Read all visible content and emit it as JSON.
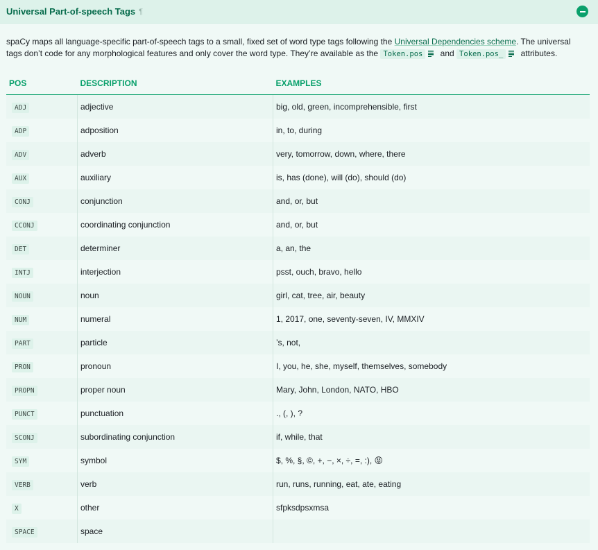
{
  "header": {
    "title": "Universal Part-of-speech Tags",
    "pilcrow": "¶"
  },
  "intro": {
    "text1": "spaCy maps all language-specific part-of-speech tags to a small, fixed set of word type tags following the ",
    "link": "Universal Dependencies scheme",
    "text2": ". The universal tags don’t code for any morphological features and only cover the word type. They’re available as the ",
    "code1": "Token.pos",
    "text3": " and ",
    "code2": "Token.pos_",
    "text4": " attributes."
  },
  "table": {
    "headers": [
      "POS",
      "DESCRIPTION",
      "EXAMPLES"
    ],
    "rows": [
      {
        "pos": "ADJ",
        "desc": "adjective",
        "ex": "big, old, green, incomprehensible, first"
      },
      {
        "pos": "ADP",
        "desc": "adposition",
        "ex": "in, to, during"
      },
      {
        "pos": "ADV",
        "desc": "adverb",
        "ex": "very, tomorrow, down, where, there"
      },
      {
        "pos": "AUX",
        "desc": "auxiliary",
        "ex": "is, has (done), will (do), should (do)"
      },
      {
        "pos": "CONJ",
        "desc": "conjunction",
        "ex": "and, or, but"
      },
      {
        "pos": "CCONJ",
        "desc": "coordinating conjunction",
        "ex": "and, or, but"
      },
      {
        "pos": "DET",
        "desc": "determiner",
        "ex": "a, an, the"
      },
      {
        "pos": "INTJ",
        "desc": "interjection",
        "ex": "psst, ouch, bravo, hello"
      },
      {
        "pos": "NOUN",
        "desc": "noun",
        "ex": "girl, cat, tree, air, beauty"
      },
      {
        "pos": "NUM",
        "desc": "numeral",
        "ex": "1, 2017, one, seventy-seven, IV, MMXIV"
      },
      {
        "pos": "PART",
        "desc": "particle",
        "ex": "’s, not,"
      },
      {
        "pos": "PRON",
        "desc": "pronoun",
        "ex": "I, you, he, she, myself, themselves, somebody"
      },
      {
        "pos": "PROPN",
        "desc": "proper noun",
        "ex": "Mary, John, London, NATO, HBO"
      },
      {
        "pos": "PUNCT",
        "desc": "punctuation",
        "ex": "., (, ), ?"
      },
      {
        "pos": "SCONJ",
        "desc": "subordinating conjunction",
        "ex": "if, while, that"
      },
      {
        "pos": "SYM",
        "desc": "symbol",
        "ex": "$, %, §, ©, +, −, ×, ÷, =, :), 😝"
      },
      {
        "pos": "VERB",
        "desc": "verb",
        "ex": "run, runs, running, eat, ate, eating"
      },
      {
        "pos": "X",
        "desc": "other",
        "ex": "sfpksdpsxmsa"
      },
      {
        "pos": "SPACE",
        "desc": "space",
        "ex": ""
      }
    ]
  }
}
